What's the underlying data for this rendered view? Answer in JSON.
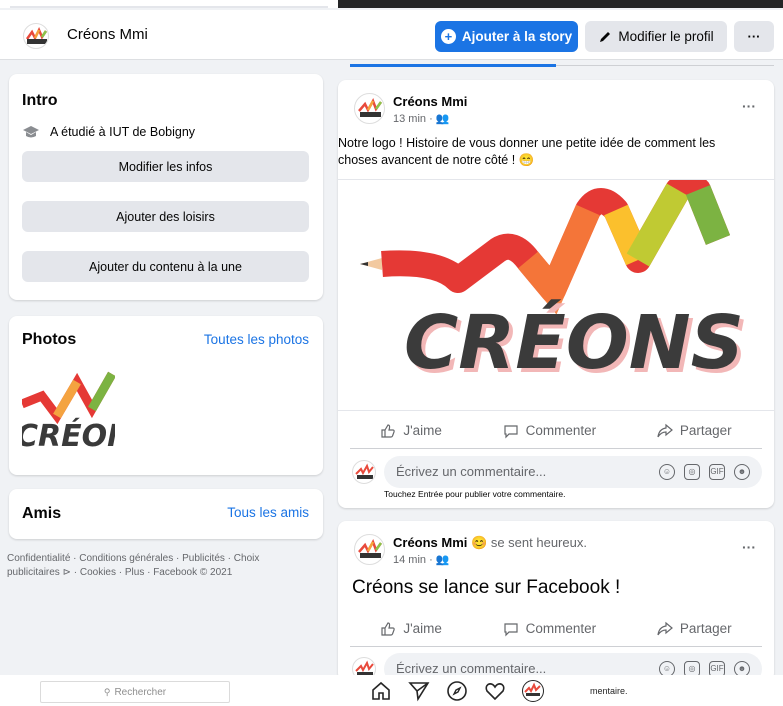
{
  "page": {
    "name": "Créons Mmi"
  },
  "header": {
    "add_story_label": "Ajouter à la story",
    "edit_profile_label": "Modifier le profil",
    "more_label": "···"
  },
  "intro": {
    "title": "Intro",
    "study_prefix": "A étudié à",
    "study_school": "IUT de Bobigny",
    "buttons": [
      "Modifier les infos",
      "Ajouter des loisirs",
      "Ajouter du contenu à la une"
    ]
  },
  "photos": {
    "title": "Photos",
    "link": "Toutes les photos"
  },
  "friends": {
    "title": "Amis",
    "link": "Tous les amis"
  },
  "footer": "Confidentialité · Conditions générales · Publicités · Choix publicitaires ⊳ · Cookies · Plus · Facebook © 2021",
  "logo_text": "CRÉONS",
  "posts": [
    {
      "author": "Créons Mmi",
      "time": "13 min · 👥",
      "text": "Notre logo ! Histoire de vous donner une petite idée de comment les choses avancent de notre côté ! 😁",
      "actions": [
        "J'aime",
        "Commenter",
        "Partager"
      ],
      "comment_placeholder": "Écrivez un commentaire...",
      "comment_hint": "Touchez Entrée pour publier votre commentaire."
    },
    {
      "author": "Créons Mmi",
      "feeling": "😊 se sent heureux.",
      "time": "14 min · 👥",
      "text": "Créons se lance sur Facebook !",
      "actions": [
        "J'aime",
        "Commenter",
        "Partager"
      ],
      "comment_placeholder": "Écrivez un commentaire...",
      "comment_hint_tail": "mentaire."
    }
  ],
  "bottom": {
    "search_placeholder": "Rechercher"
  },
  "colors": {
    "accent": "#1b74e4",
    "bg": "#f0f2f5"
  }
}
